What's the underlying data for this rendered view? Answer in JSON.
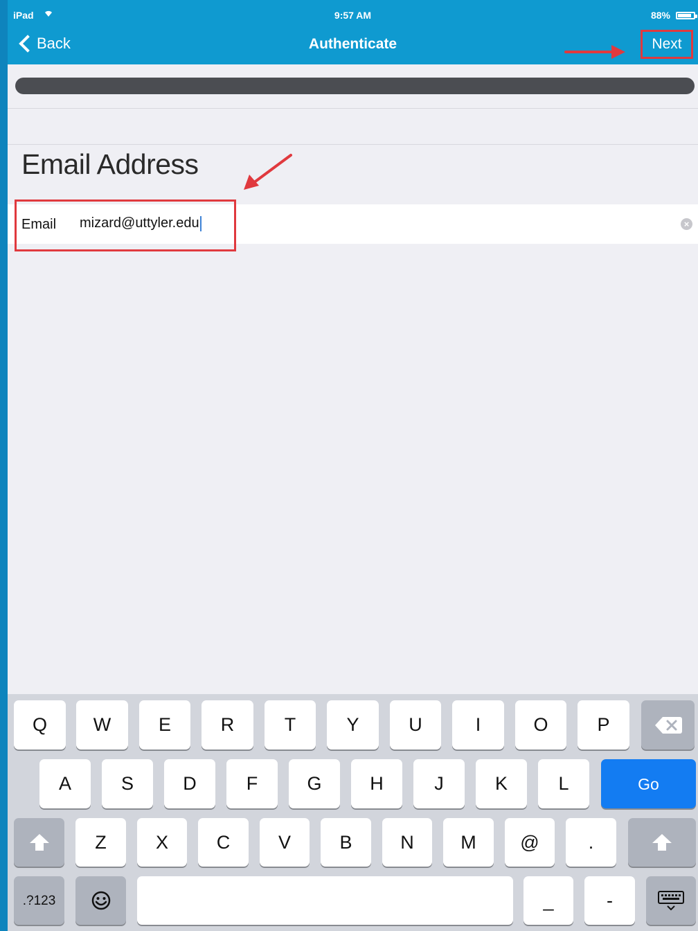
{
  "status_bar": {
    "device": "iPad",
    "time": "9:57 AM",
    "battery": "88%",
    "battery_level": 0.88
  },
  "nav": {
    "back_label": "Back",
    "title": "Authenticate",
    "next_label": "Next"
  },
  "progress": {
    "value_fraction": 1.0
  },
  "section": {
    "title": "Email Address"
  },
  "email": {
    "label": "Email",
    "value": "mizard@uttyler.edu"
  },
  "keyboard": {
    "row1": [
      "Q",
      "W",
      "E",
      "R",
      "T",
      "Y",
      "U",
      "I",
      "O",
      "P"
    ],
    "row2": [
      "A",
      "S",
      "D",
      "F",
      "G",
      "H",
      "J",
      "K",
      "L"
    ],
    "go_label": "Go",
    "row3": [
      "Z",
      "X",
      "C",
      "V",
      "B",
      "N",
      "M",
      "@",
      "."
    ],
    "numbers_label": ".?123",
    "row4_symbols": [
      "_",
      "-"
    ],
    "icons": [
      "delete-icon",
      "shift-icon",
      "emoji-icon",
      "keyboard-dismiss-icon",
      "wifi-icon",
      "battery-icon",
      "chevron-left-icon",
      "clear-icon"
    ]
  },
  "colors": {
    "header": "#0f9ad0",
    "highlight": "#e0393e",
    "go_key": "#137cf2",
    "progress": "#4b4d52"
  }
}
